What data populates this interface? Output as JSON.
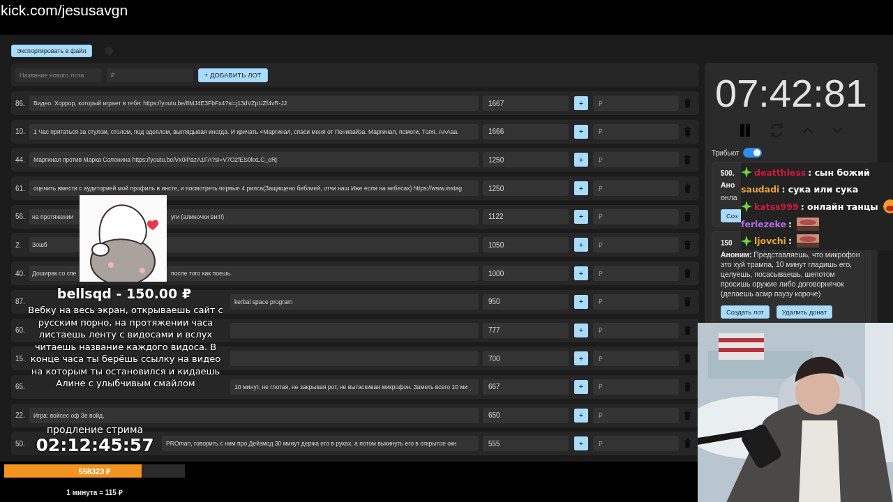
{
  "browser": {
    "url": "kick.com/jesusavgn"
  },
  "toolbar": {
    "export_button": "Экспортировать в файл"
  },
  "new_lot": {
    "name_placeholder": "Название нового лота",
    "price_placeholder": "₽",
    "add_button": "+ ДОБАВИТЬ ЛОТ"
  },
  "lots": [
    {
      "number": "86.",
      "text": "Видео. Хоррор, который играет в тебя: https://youtu.be/8MJ4E3FbFx4?si=j13dVZpUZf4vR-JJ",
      "value": "1667",
      "add_button": "+",
      "price_placeholder": "₽"
    },
    {
      "number": "10.",
      "text": "1 Час прятаться за стулом, столом, под одеялом, выглядывая иногда. И кричать «Маргинал, спаси меня от Пенивайза. Маргинал, помоги, Толя. АААаа.",
      "value": "1666",
      "add_button": "+",
      "price_placeholder": "₽"
    },
    {
      "number": "44.",
      "text": "Маргинал против Марка Солонина https://youtu.be/Vx0iPazA1FA?si=V7O2fES0kxLC_eRj",
      "value": "1250",
      "add_button": "+",
      "price_placeholder": "₽"
    },
    {
      "number": "61.",
      "text": "оценить вмести с аудиторией мой профиль в инсте, и посмотреть первые 4 рилса(Защищено библией, отчи наш Иже если на небесах) https://www.instag",
      "value": "1250",
      "add_button": "+",
      "price_placeholder": "₽"
    },
    {
      "number": "56.",
      "text": "на протяжении",
      "text_right": "уги (алиночки ви!!!)",
      "value": "1122",
      "add_button": "+",
      "price_placeholder": "₽"
    },
    {
      "number": "2.",
      "text": "Зошб",
      "value": "1050",
      "add_button": "+",
      "price_placeholder": "₽"
    },
    {
      "number": "40.",
      "text": "Доширак со спе",
      "text_right": "после того как поешь.",
      "value": "1000",
      "add_button": "+",
      "price_placeholder": "₽"
    },
    {
      "number": "87.",
      "text_right": "kerbal space program",
      "value": "950",
      "add_button": "+",
      "price_placeholder": "₽"
    },
    {
      "number": "60.",
      "value": "777",
      "add_button": "+",
      "price_placeholder": "₽"
    },
    {
      "number": "15.",
      "value": "700",
      "add_button": "+",
      "price_placeholder": "₽"
    },
    {
      "number": "65.",
      "text_right": "10 минут, не глотая, не закрывая рот, не вытаскивая микрофон. Заметь всего 10 ми",
      "value": "667",
      "add_button": "+",
      "price_placeholder": "₽"
    },
    {
      "number": "22.",
      "text": "Игра: войсес оф Зе войд.",
      "value": "650",
      "add_button": "+",
      "price_placeholder": "₽"
    },
    {
      "number": "50.",
      "text_right": "PROman, говорить с ним про Дейзмод 30 минут держа его в руках, а потом выкинуть его в открытое окн",
      "value": "555",
      "add_button": "+",
      "price_placeholder": "₽"
    }
  ],
  "timer": {
    "time": "07:42:81"
  },
  "tribute": {
    "label": "Трибьют",
    "on": true
  },
  "donations": [
    {
      "amount": "500.",
      "message": "**Ано**",
      "line_2": "онла",
      "buttons": [
        "Соз"
      ]
    },
    {
      "amount": "150",
      "message": "**Аноним:** Представляешь, что микрофон это хуй трампа, 10 минут гладишь его, целуешь, посасываешь, шепотом просишь оружие либо договорнячок (делаешь асмр паузу короче)",
      "buttons": [
        "Создать лот",
        "Удалить донат"
      ]
    }
  ],
  "chat": [
    {
      "user": "deatthless",
      "color": "#d4163c",
      "badge": true,
      "text": ": сын божий"
    },
    {
      "user": "saudadi",
      "color": "#e9a23b",
      "badge": false,
      "text": ": сука или сука"
    },
    {
      "user": "katss999",
      "color": "#d4163c",
      "badge": true,
      "text": ": онлайн танцы",
      "emoji": true
    },
    {
      "user": "ferlezeke",
      "color": "#b46ee6",
      "badge": false,
      "text": ":",
      "emote": true
    },
    {
      "user": "ljovchi",
      "color": "#e9a23b",
      "badge": true,
      "text": ":",
      "emote": true
    }
  ],
  "alert": {
    "title": "bellsqd - 150.00 ₽",
    "message": "Вебку на весь экран, открываешь сайт с русским порно, на протяжении часа листаешь ленту с видосами и вслух читаешь название каждого видоса. В конце часа ты берёшь ссылку на видео на которым ты остановился и кидаешь Алине с улыбчивым смайлом"
  },
  "extension": {
    "label": "продление стрима",
    "time": "02:12:45:57"
  },
  "goal": {
    "amount": "558323 ₽",
    "level": 0.76,
    "rate": "1 минута = 115 ₽"
  }
}
